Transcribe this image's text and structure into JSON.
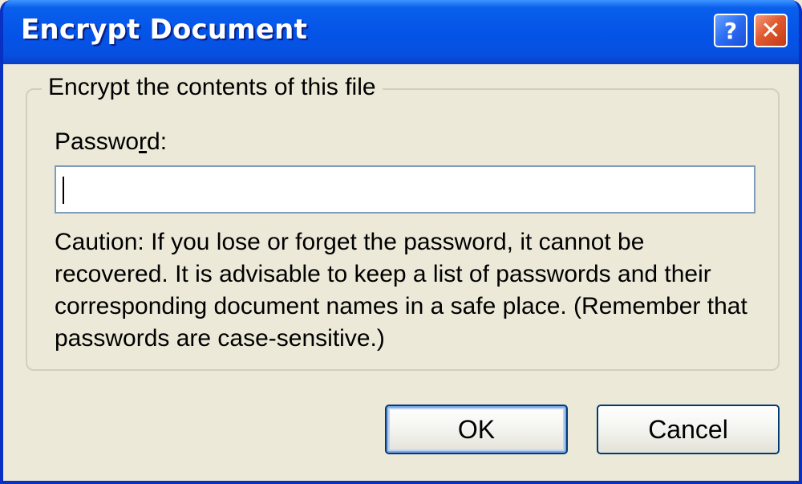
{
  "window": {
    "title": "Encrypt Document",
    "help_glyph": "?",
    "close_glyph": "✕"
  },
  "group": {
    "legend": "Encrypt the contents of this file"
  },
  "password": {
    "label_before": "Passwo",
    "label_accel": "r",
    "label_after": "d:",
    "value": "",
    "placeholder": ""
  },
  "caution": {
    "text": "Caution: If you lose or forget the password, it cannot be recovered. It is advisable to keep a list of passwords and their corresponding document names in a safe place. (Remember that passwords are case-sensitive.)"
  },
  "buttons": {
    "ok_label": "OK",
    "cancel_label": "Cancel"
  },
  "colors": {
    "titlebar": "#0454e8",
    "face": "#ece9d8",
    "close": "#e05a30",
    "help": "#2a6cf2"
  },
  "icons": {
    "help": "help-icon",
    "close": "close-icon"
  }
}
